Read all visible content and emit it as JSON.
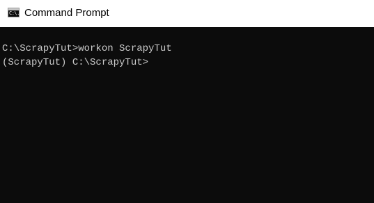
{
  "window": {
    "title": "Command Prompt",
    "icon": "command-prompt-icon",
    "icon_glyph": "C:\\."
  },
  "console": {
    "background_color": "#0c0c0c",
    "text_color": "#cccccc",
    "lines": [
      "C:\\ScrapyTut>workon ScrapyTut",
      "(ScrapyTut) C:\\ScrapyTut>"
    ]
  }
}
